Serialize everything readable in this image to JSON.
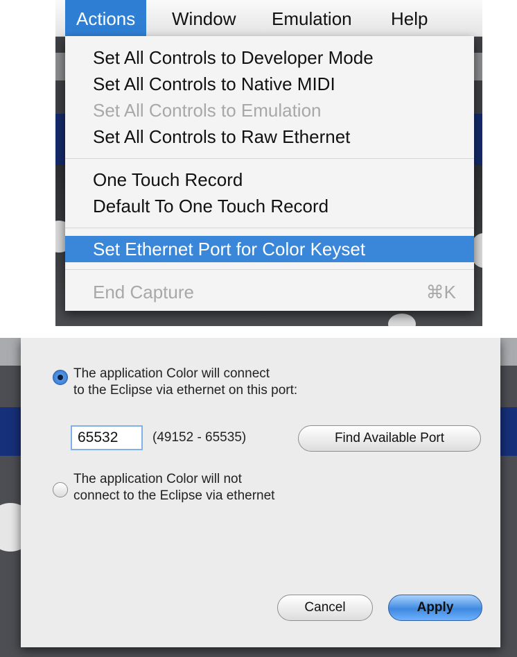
{
  "menubar": {
    "items": [
      "Actions",
      "Window",
      "Emulation",
      "Help"
    ],
    "active_index": 0
  },
  "actions_menu": {
    "items": [
      {
        "label": "Set All Controls to Developer Mode",
        "enabled": true
      },
      {
        "label": "Set All Controls to Native MIDI",
        "enabled": true
      },
      {
        "label": "Set All Controls to Emulation",
        "enabled": false
      },
      {
        "label": "Set All Controls to Raw Ethernet",
        "enabled": true
      },
      {
        "label": "One Touch Record",
        "enabled": true
      },
      {
        "label": "Default To One Touch Record",
        "enabled": true
      },
      {
        "label": "Set Ethernet Port for Color Keyset",
        "enabled": true,
        "highlighted": true
      },
      {
        "label": "End Capture",
        "enabled": false,
        "shortcut": "⌘K"
      }
    ]
  },
  "dialog": {
    "option_connect": {
      "line1": "The application Color will connect",
      "line2": "to the Eclipse via ethernet on this port:",
      "selected": true
    },
    "port": {
      "value": "65532",
      "range": "(49152 - 65535)"
    },
    "find_port_label": "Find Available Port",
    "option_no_connect": {
      "line1": "The application Color will not",
      "line2": "connect to the Eclipse via ethernet",
      "selected": false
    },
    "cancel_label": "Cancel",
    "apply_label": "Apply"
  },
  "colors": {
    "menu_highlight": "#3a86d8",
    "menubar_active": "#2e7fd4",
    "disabled_text": "#a8a8a8",
    "default_button": "#3f8ae0"
  }
}
